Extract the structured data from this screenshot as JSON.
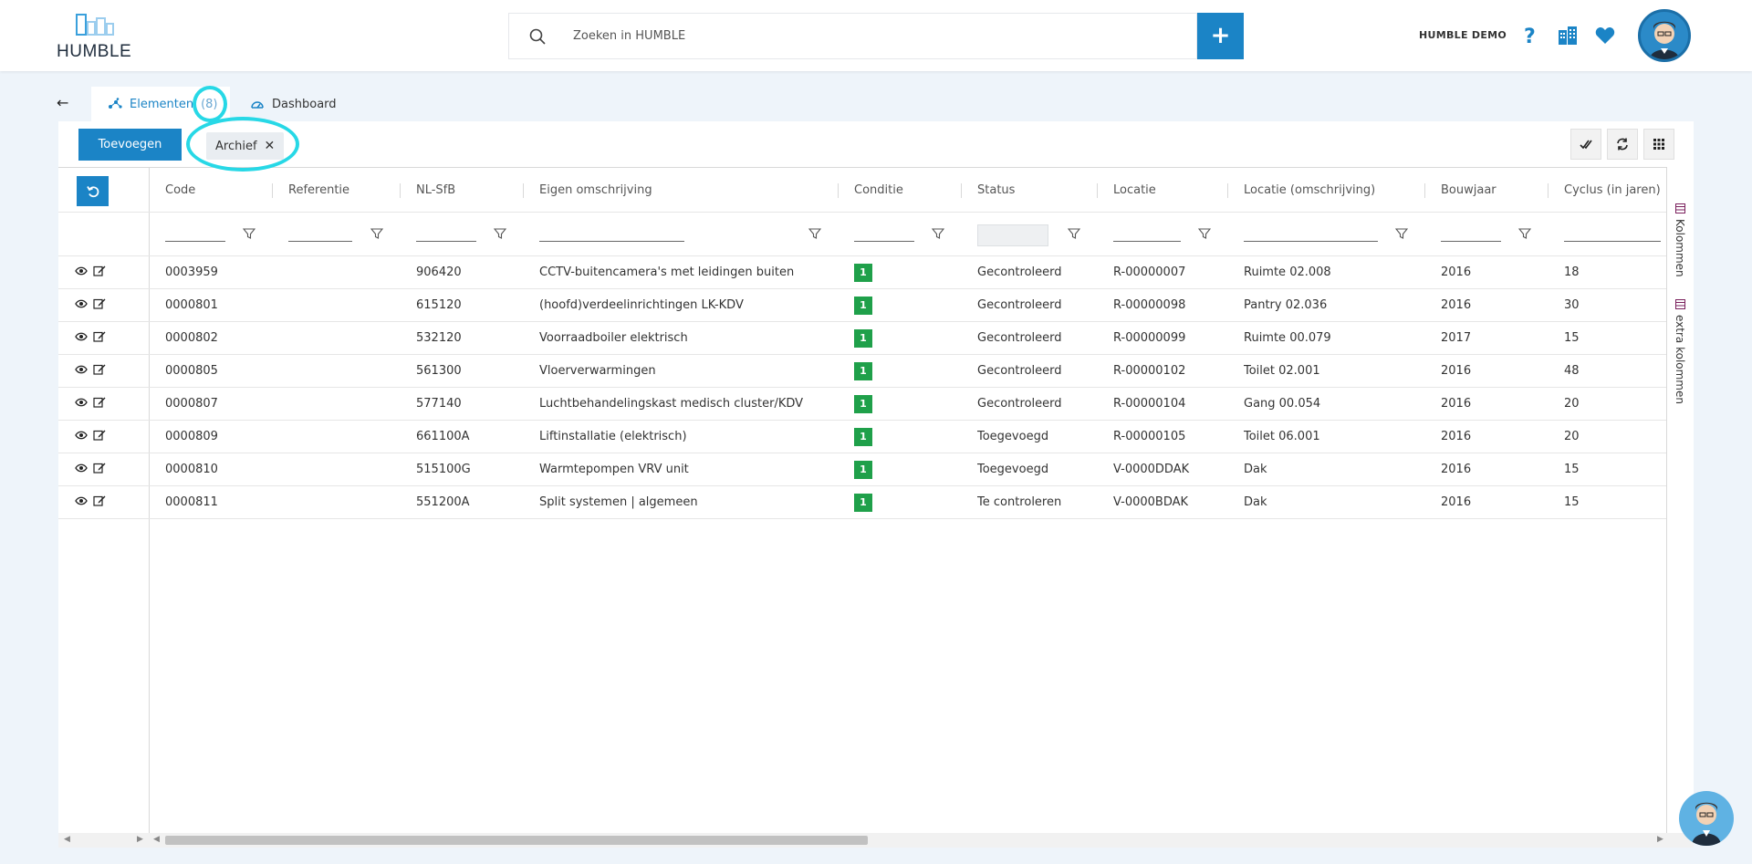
{
  "app": {
    "logo_text": "HUMBLE",
    "org_name": "HUMBLE DEMO"
  },
  "search": {
    "placeholder": "Zoeken in HUMBLE",
    "add_label": "+"
  },
  "tabs": [
    {
      "label": "Elementen",
      "count": "(8)"
    },
    {
      "label": "Dashboard"
    }
  ],
  "toolbar": {
    "add_label": "Toevoegen",
    "filter_chip": "Archief",
    "chip_close": "✕"
  },
  "columns": [
    "Code",
    "Referentie",
    "NL-SfB",
    "Eigen omschrijving",
    "Conditie",
    "Status",
    "Locatie",
    "Locatie (omschrijving)",
    "Bouwjaar",
    "Cyclus (in jaren)"
  ],
  "rows": [
    {
      "code": "0003959",
      "referentie": "",
      "nlsfb": "906420",
      "omschrijving": "CCTV-buitencamera's met leidingen buiten",
      "conditie": "1",
      "status": "Gecontroleerd",
      "locatie": "R-00000007",
      "locatie_oms": "Ruimte 02.008",
      "bouwjaar": "2016",
      "cyclus": "18"
    },
    {
      "code": "0000801",
      "referentie": "",
      "nlsfb": "615120",
      "omschrijving": "(hoofd)verdeelinrichtingen LK-KDV",
      "conditie": "1",
      "status": "Gecontroleerd",
      "locatie": "R-00000098",
      "locatie_oms": "Pantry 02.036",
      "bouwjaar": "2016",
      "cyclus": "30"
    },
    {
      "code": "0000802",
      "referentie": "",
      "nlsfb": "532120",
      "omschrijving": "Voorraadboiler elektrisch",
      "conditie": "1",
      "status": "Gecontroleerd",
      "locatie": "R-00000099",
      "locatie_oms": "Ruimte 00.079",
      "bouwjaar": "2017",
      "cyclus": "15"
    },
    {
      "code": "0000805",
      "referentie": "",
      "nlsfb": "561300",
      "omschrijving": "Vloerverwarmingen",
      "conditie": "1",
      "status": "Gecontroleerd",
      "locatie": "R-00000102",
      "locatie_oms": "Toilet 02.001",
      "bouwjaar": "2016",
      "cyclus": "48"
    },
    {
      "code": "0000807",
      "referentie": "",
      "nlsfb": "577140",
      "omschrijving": "Luchtbehandelingskast medisch cluster/KDV",
      "conditie": "1",
      "status": "Gecontroleerd",
      "locatie": "R-00000104",
      "locatie_oms": "Gang 00.054",
      "bouwjaar": "2016",
      "cyclus": "20"
    },
    {
      "code": "0000809",
      "referentie": "",
      "nlsfb": "661100A",
      "omschrijving": "Liftinstallatie (elektrisch)",
      "conditie": "1",
      "status": "Toegevoegd",
      "locatie": "R-00000105",
      "locatie_oms": "Toilet 06.001",
      "bouwjaar": "2016",
      "cyclus": "20"
    },
    {
      "code": "0000810",
      "referentie": "",
      "nlsfb": "515100G",
      "omschrijving": "Warmtepompen VRV unit",
      "conditie": "1",
      "status": "Toegevoegd",
      "locatie": "V-0000DDAK",
      "locatie_oms": "Dak",
      "bouwjaar": "2016",
      "cyclus": "15"
    },
    {
      "code": "0000811",
      "referentie": "",
      "nlsfb": "551200A",
      "omschrijving": "Split systemen | algemeen",
      "conditie": "1",
      "status": "Te controleren",
      "locatie": "V-0000BDAK",
      "locatie_oms": "Dak",
      "bouwjaar": "2016",
      "cyclus": "15"
    }
  ],
  "side_panel": {
    "columns_label": "Kolommen",
    "extra_columns_label": "extra kolommen"
  },
  "colors": {
    "brand": "#1b84c6",
    "condition_good": "#1fa04a",
    "highlight": "#27d8e6"
  }
}
